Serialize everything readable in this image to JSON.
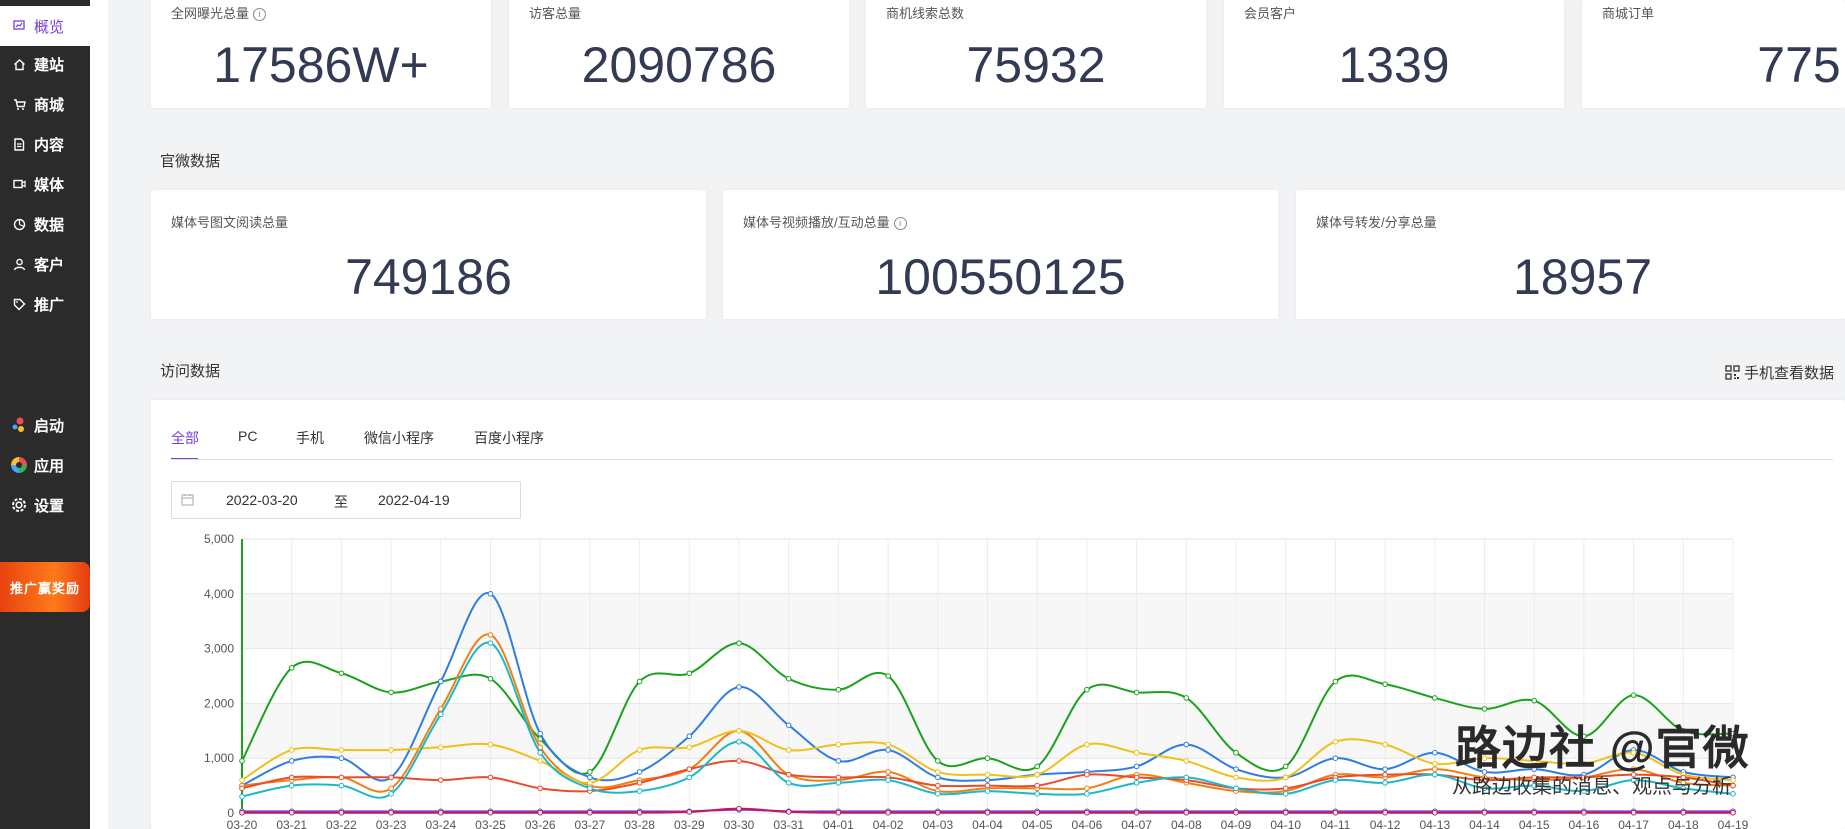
{
  "sidebar": {
    "items": [
      {
        "label": "概览",
        "icon": "overview-icon",
        "active": true
      },
      {
        "label": "建站",
        "icon": "home-icon"
      },
      {
        "label": "商城",
        "icon": "cart-icon"
      },
      {
        "label": "内容",
        "icon": "document-icon"
      },
      {
        "label": "媒体",
        "icon": "video-icon"
      },
      {
        "label": "数据",
        "icon": "pie-chart-icon"
      },
      {
        "label": "客户",
        "icon": "user-icon"
      },
      {
        "label": "推广",
        "icon": "tag-icon"
      }
    ],
    "bottom_items": [
      {
        "label": "启动",
        "icon": "launch-icon"
      },
      {
        "label": "应用",
        "icon": "apps-icon"
      },
      {
        "label": "设置",
        "icon": "settings-icon"
      }
    ],
    "promo_label": "推广赢奖励"
  },
  "top_stats": [
    {
      "label": "全网曝光总量",
      "value": "17586W+",
      "info": true
    },
    {
      "label": "访客总量",
      "value": "2090786"
    },
    {
      "label": "商机线索总数",
      "value": "75932"
    },
    {
      "label": "会员客户",
      "value": "1339"
    },
    {
      "label": "商城订单",
      "value": "775"
    }
  ],
  "official": {
    "title": "官微数据",
    "stats": [
      {
        "label": "媒体号图文阅读总量",
        "value": "749186"
      },
      {
        "label": "媒体号视频播放/互动总量",
        "value": "100550125",
        "info": true
      },
      {
        "label": "媒体号转发/分享总量",
        "value": "18957"
      }
    ]
  },
  "visits": {
    "title": "访问数据",
    "mobile_view_label": "手机查看数据",
    "tabs": [
      "全部",
      "PC",
      "手机",
      "微信小程序",
      "百度小程序"
    ],
    "active_tab": 0,
    "date_start": "2022-03-20",
    "date_sep": "至",
    "date_end": "2022-04-19"
  },
  "colors": {
    "accent": "#7a3fd9",
    "sidebar_bg": "#2b2b2b",
    "number": "#333a54"
  },
  "watermark": {
    "title": "路边社 @官微",
    "subtitle": "从路边收集的消息、观点与分析"
  },
  "chart_data": {
    "type": "line",
    "x": [
      "03-20",
      "03-21",
      "03-22",
      "03-23",
      "03-24",
      "03-25",
      "03-26",
      "03-27",
      "03-28",
      "03-29",
      "03-30",
      "03-31",
      "04-01",
      "04-02",
      "04-03",
      "04-04",
      "04-05",
      "04-06",
      "04-07",
      "04-08",
      "04-09",
      "04-10",
      "04-11",
      "04-12",
      "04-13",
      "04-14",
      "04-15",
      "04-16",
      "04-17",
      "04-18",
      "04-19"
    ],
    "ylim": [
      0,
      5000
    ],
    "yticks": [
      "0",
      "1,000",
      "2,000",
      "3,000",
      "4,000",
      "5,000"
    ],
    "grid": true,
    "series": [
      {
        "color": "#1aa31a",
        "values": [
          950,
          2650,
          2550,
          2200,
          2400,
          2450,
          1350,
          750,
          2400,
          2550,
          3100,
          2450,
          2250,
          2500,
          950,
          1000,
          850,
          2250,
          2200,
          2100,
          1100,
          850,
          2400,
          2350,
          2100,
          1900,
          2050,
          1400,
          2150,
          1500,
          1450
        ]
      },
      {
        "color": "#2f7de1",
        "values": [
          500,
          950,
          1000,
          650,
          2400,
          4000,
          1450,
          650,
          750,
          1400,
          2300,
          1600,
          950,
          1150,
          650,
          600,
          700,
          750,
          850,
          1250,
          800,
          650,
          1000,
          800,
          1100,
          750,
          800,
          700,
          1150,
          750,
          650
        ]
      },
      {
        "color": "#f07f14",
        "values": [
          500,
          600,
          650,
          450,
          1900,
          3250,
          1200,
          500,
          600,
          800,
          1500,
          700,
          600,
          750,
          400,
          450,
          450,
          450,
          700,
          550,
          400,
          400,
          700,
          650,
          800,
          650,
          600,
          650,
          800,
          550,
          500
        ]
      },
      {
        "color": "#f0c019",
        "values": [
          600,
          1150,
          1150,
          1150,
          1200,
          1250,
          950,
          550,
          1150,
          1200,
          1500,
          1150,
          1250,
          1250,
          750,
          700,
          700,
          1250,
          1100,
          950,
          650,
          650,
          1300,
          1250,
          900,
          1000,
          950,
          900,
          1100,
          700,
          600
        ]
      },
      {
        "color": "#ea4b2b",
        "values": [
          450,
          650,
          650,
          650,
          600,
          650,
          450,
          400,
          550,
          800,
          950,
          700,
          650,
          650,
          500,
          500,
          500,
          700,
          650,
          600,
          450,
          450,
          650,
          700,
          700,
          600,
          650,
          650,
          700,
          650,
          500
        ]
      },
      {
        "color": "#1ab8c8",
        "values": [
          300,
          500,
          500,
          350,
          1800,
          3100,
          1100,
          450,
          400,
          650,
          1300,
          550,
          550,
          600,
          350,
          400,
          350,
          350,
          550,
          650,
          450,
          350,
          600,
          550,
          700,
          450,
          500,
          400,
          600,
          450,
          350
        ]
      },
      {
        "color": "#7a3fd9",
        "values": [
          30,
          30,
          30,
          30,
          30,
          30,
          30,
          30,
          30,
          30,
          60,
          30,
          30,
          30,
          30,
          30,
          30,
          30,
          30,
          30,
          30,
          30,
          30,
          30,
          30,
          30,
          30,
          30,
          30,
          30,
          30
        ]
      },
      {
        "color": "#c2185b",
        "values": [
          5,
          5,
          5,
          5,
          5,
          5,
          5,
          5,
          5,
          20,
          80,
          20,
          5,
          5,
          5,
          5,
          5,
          5,
          5,
          5,
          5,
          5,
          5,
          5,
          5,
          5,
          5,
          5,
          5,
          5,
          5
        ]
      }
    ]
  }
}
